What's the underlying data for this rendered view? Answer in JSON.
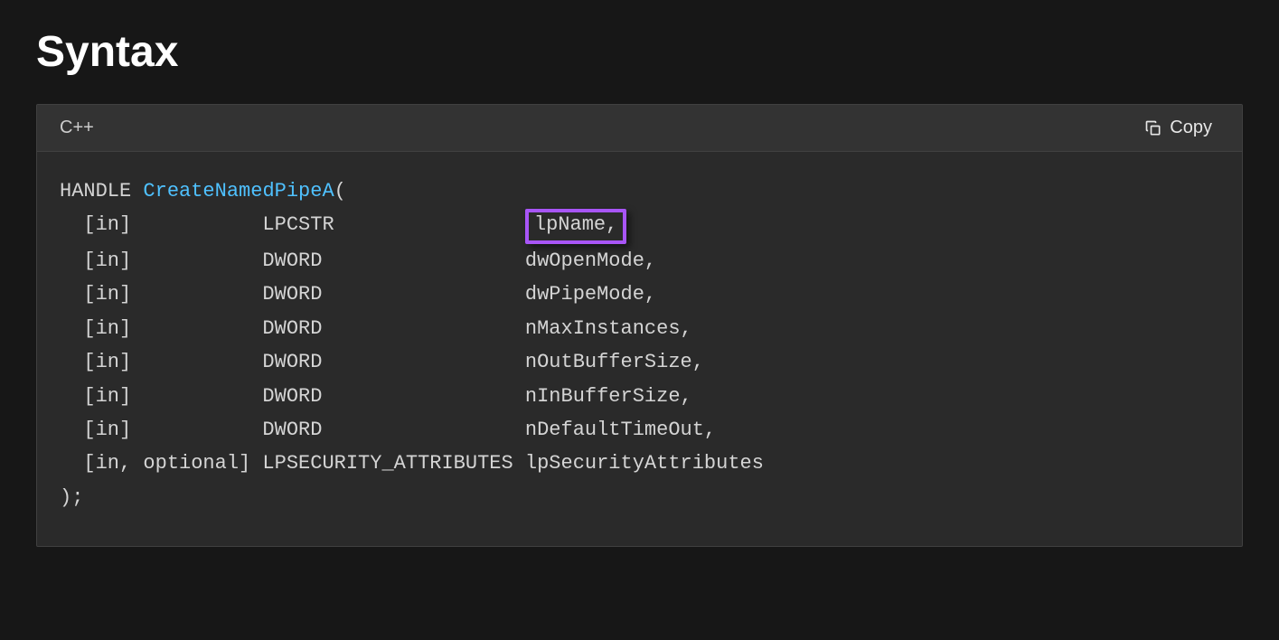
{
  "heading": "Syntax",
  "code_header": {
    "language": "C++",
    "copy_label": "Copy"
  },
  "signature": {
    "return_type": "HANDLE",
    "function_name": "CreateNamedPipeA",
    "open_paren": "(",
    "close": ");",
    "params": [
      {
        "dir": "[in]",
        "type": "LPCSTR",
        "name": "lpName",
        "comma": ","
      },
      {
        "dir": "[in]",
        "type": "DWORD",
        "name": "dwOpenMode",
        "comma": ","
      },
      {
        "dir": "[in]",
        "type": "DWORD",
        "name": "dwPipeMode",
        "comma": ","
      },
      {
        "dir": "[in]",
        "type": "DWORD",
        "name": "nMaxInstances",
        "comma": ","
      },
      {
        "dir": "[in]",
        "type": "DWORD",
        "name": "nOutBufferSize",
        "comma": ","
      },
      {
        "dir": "[in]",
        "type": "DWORD",
        "name": "nInBufferSize",
        "comma": ","
      },
      {
        "dir": "[in]",
        "type": "DWORD",
        "name": "nDefaultTimeOut",
        "comma": ","
      },
      {
        "dir": "[in, optional]",
        "type": "LPSECURITY_ATTRIBUTES",
        "name": "lpSecurityAttributes",
        "comma": ""
      }
    ],
    "highlight_param_index": 0,
    "col_dir_width": 15,
    "col_type_width": 22
  }
}
